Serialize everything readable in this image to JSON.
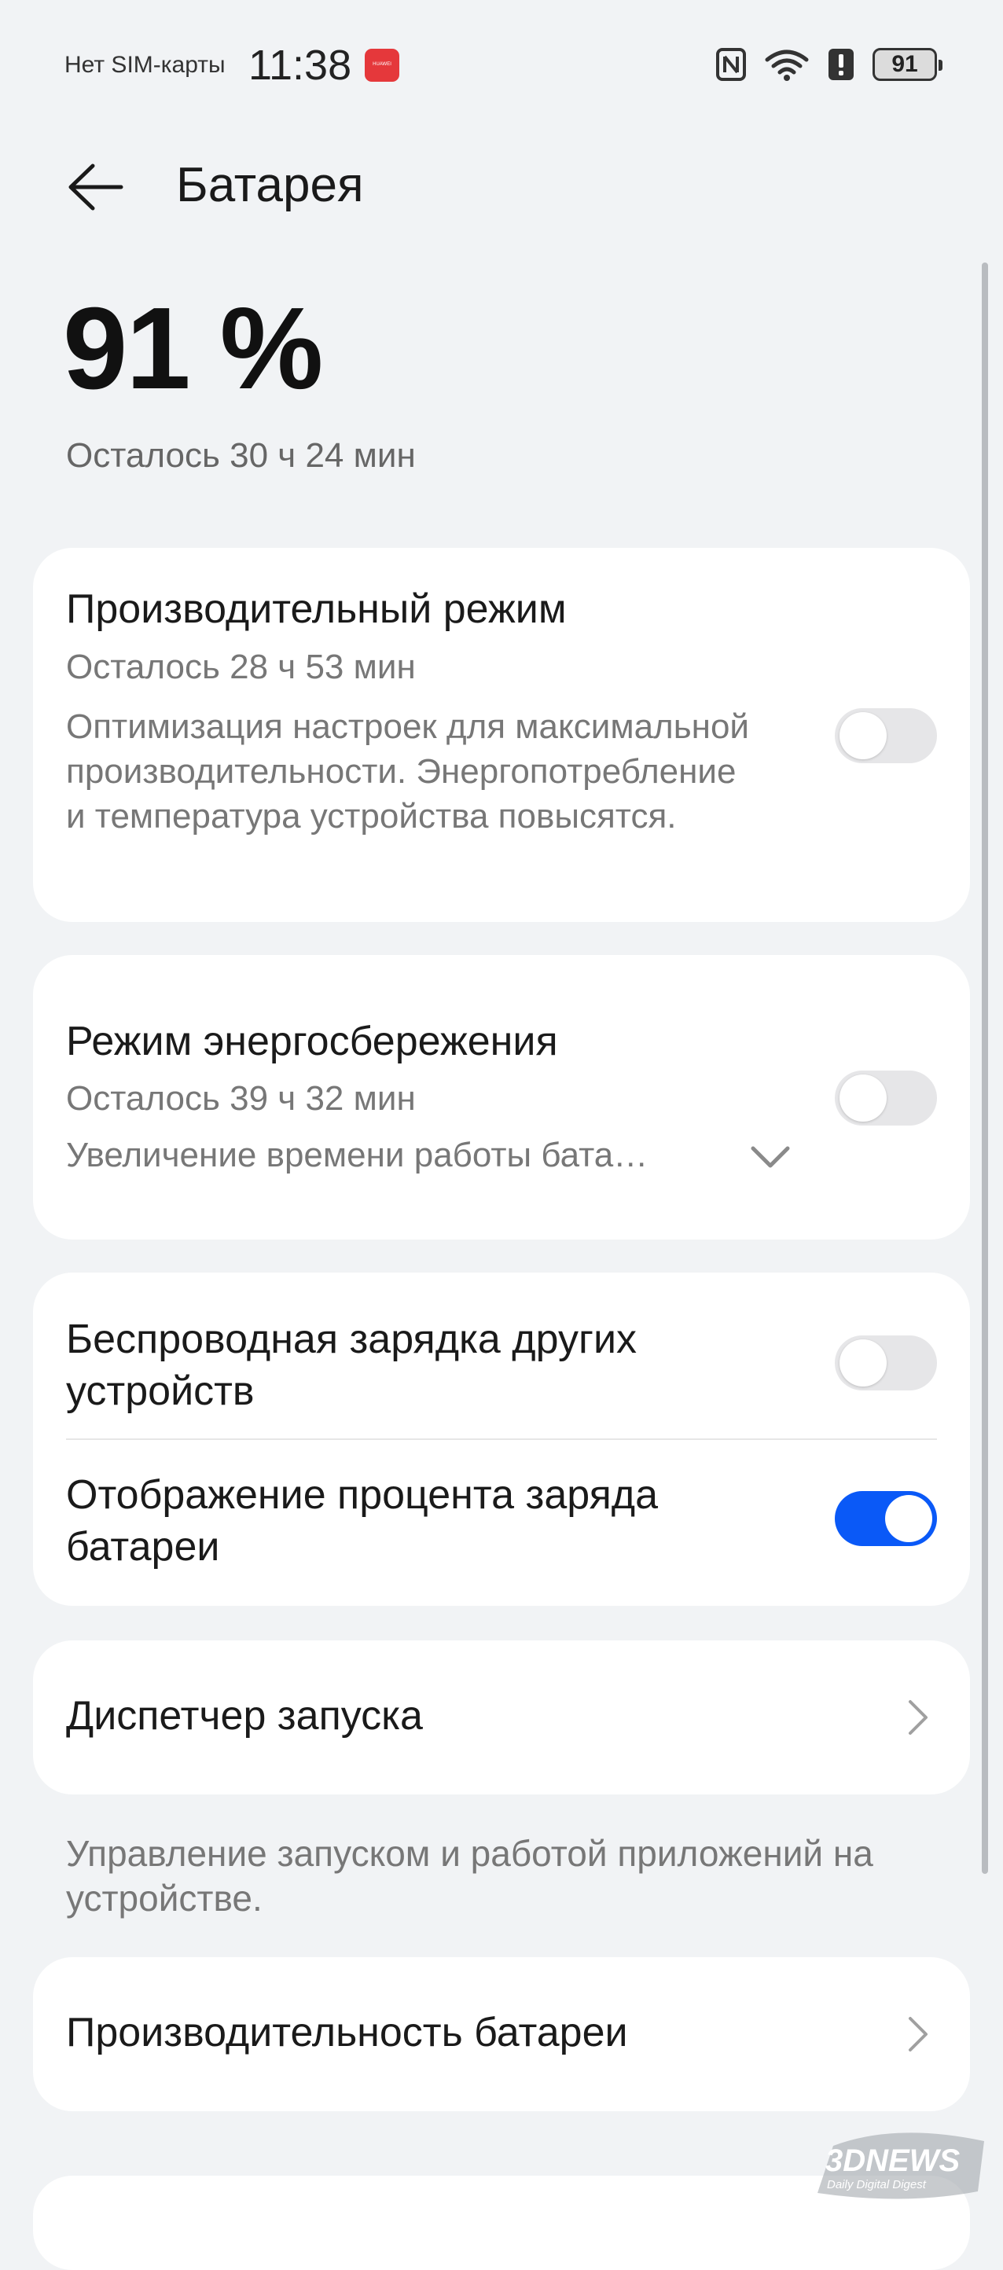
{
  "status_bar": {
    "carrier": "Нет SIM-карты",
    "time": "11:38",
    "app_icon_label": "HUAWEI",
    "battery_level": "91",
    "icons": [
      "nfc-icon",
      "wifi-icon",
      "alert-icon",
      "battery-icon"
    ]
  },
  "header": {
    "title": "Батарея"
  },
  "battery": {
    "percent": "91 %",
    "remaining": "Осталось 30 ч 24 мин"
  },
  "performance_mode": {
    "title": "Производительный режим",
    "remaining": "Осталось 28 ч 53 мин",
    "description": "Оптимизация настроек для максимальной производительности. Энергопотребление и температура устройства повысятся.",
    "enabled": false
  },
  "power_saving_mode": {
    "title": "Режим энергосбережения",
    "remaining": "Осталось 39 ч 32 мин",
    "description": "Увеличение времени работы бата…",
    "enabled": false
  },
  "wireless_charging": {
    "title": "Беспроводная зарядка других устройств",
    "enabled": false
  },
  "battery_percentage": {
    "title": "Отображение процента заряда батареи",
    "enabled": true
  },
  "launch_manager": {
    "title": "Диспетчер запуска",
    "note": "Управление запуском и работой приложений на устройстве."
  },
  "battery_performance": {
    "title": "Производительность батареи"
  },
  "watermark": {
    "brand": "3DNEWS",
    "tagline": "Daily Digital Digest"
  },
  "colors": {
    "background": "#f1f3f5",
    "card": "#ffffff",
    "accent": "#0a59f7",
    "secondary_text": "#777777"
  }
}
